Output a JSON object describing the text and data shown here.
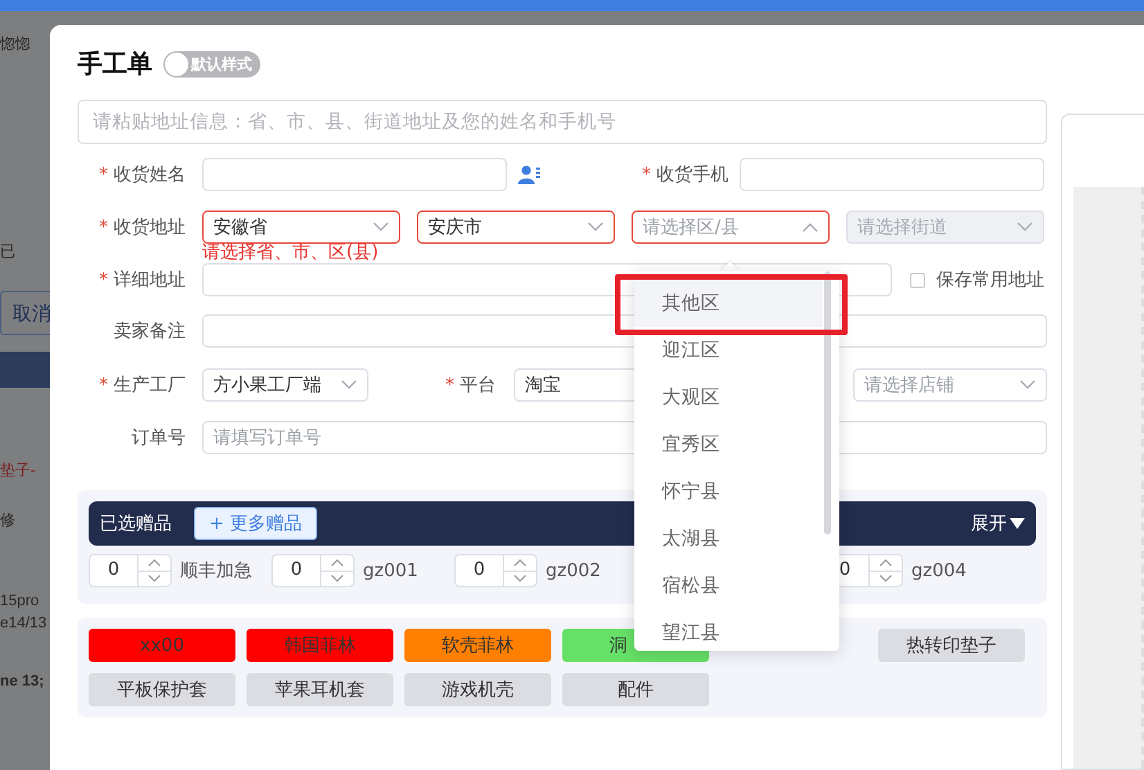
{
  "backdrop": [
    {
      "kind": "text",
      "text": "惚惚"
    },
    {
      "kind": "text",
      "text": "已"
    },
    {
      "kind": "button",
      "text": "取消"
    },
    {
      "kind": "link",
      "text": "垫子-"
    },
    {
      "kind": "edit",
      "text": "修"
    },
    {
      "kind": "text",
      "text": "15pro"
    },
    {
      "kind": "text",
      "text": "e14/13"
    },
    {
      "kind": "bold",
      "text": "ne 13;"
    }
  ],
  "dialog": {
    "title": "手工单",
    "style_toggle": {
      "label": "默认样式",
      "on": false
    },
    "paste_box": {
      "placeholder": "请粘贴地址信息：省、市、县、街道地址及您的姓名和手机号"
    },
    "name": {
      "mark": "*",
      "label": "收货姓名"
    },
    "phone": {
      "mark": "*",
      "label": "收货手机"
    },
    "address": {
      "mark": "*",
      "label": "收货地址",
      "error_text": "请选择省、市、区(县)",
      "selects": [
        {
          "value": "安徽省",
          "error": true,
          "open": false,
          "disabled": false
        },
        {
          "value": "安庆市",
          "error": true,
          "open": false,
          "disabled": false
        },
        {
          "placeholder": "请选择区/县",
          "error": true,
          "open": true,
          "disabled": false
        },
        {
          "placeholder": "请选择街道",
          "error": false,
          "open": false,
          "disabled": true
        }
      ]
    },
    "detail": {
      "mark": "*",
      "label": "详细地址"
    },
    "save_address": {
      "label": "保存常用地址",
      "checked": false
    },
    "seller_note": {
      "label": "卖家备注"
    },
    "factory": {
      "mark": "*",
      "label": "生产工厂",
      "value": "方小果工厂端"
    },
    "platform": {
      "mark": "*",
      "label": "平台",
      "value": "淘宝"
    },
    "shop": {
      "placeholder": "请选择店铺"
    },
    "order_no": {
      "label": "订单号",
      "placeholder": "请填写订单号"
    },
    "gifts": {
      "title": "已选赠品",
      "more_button": "+ 更多赠品",
      "expand": "展开",
      "items": [
        {
          "kind": "spinner",
          "quantity": "0",
          "name": "顺丰加急"
        },
        {
          "kind": "spinner",
          "quantity": "0",
          "name": "gz001"
        },
        {
          "kind": "spinner",
          "quantity": "0",
          "name": "gz002"
        },
        {
          "kind": "covered"
        },
        {
          "kind": "spinner",
          "quantity": "0",
          "name": "gz004"
        }
      ]
    },
    "tags": [
      {
        "kind": "tag",
        "label": "xx00",
        "color": "#ff0000"
      },
      {
        "kind": "tag",
        "label": "韩国菲林",
        "color": "#ff0000"
      },
      {
        "kind": "tag",
        "label": "软壳菲林",
        "color": "#ff7f00"
      },
      {
        "kind": "tag",
        "label": "洞",
        "color": "#66e066"
      },
      {
        "kind": "covered"
      },
      {
        "kind": "tag",
        "label": "热转印垫子",
        "color": "#dcdde2"
      },
      {
        "kind": "tag",
        "label": "平板保护套",
        "color": "#dcdde2"
      },
      {
        "kind": "tag",
        "label": "苹果耳机套",
        "color": "#dcdde2"
      },
      {
        "kind": "tag",
        "label": "游戏机壳",
        "color": "#dcdde2"
      },
      {
        "kind": "tag",
        "label": "配件",
        "color": "#dcdde2"
      }
    ],
    "district_menu": {
      "options": [
        {
          "label": "其他区",
          "highlighted": true
        },
        {
          "label": "迎江区",
          "highlighted": false
        },
        {
          "label": "大观区",
          "highlighted": false
        },
        {
          "label": "宜秀区",
          "highlighted": false
        },
        {
          "label": "怀宁县",
          "highlighted": false
        },
        {
          "label": "太湖县",
          "highlighted": false
        },
        {
          "label": "宿松县",
          "highlighted": false
        },
        {
          "label": "望江县",
          "highlighted": false
        }
      ]
    }
  }
}
